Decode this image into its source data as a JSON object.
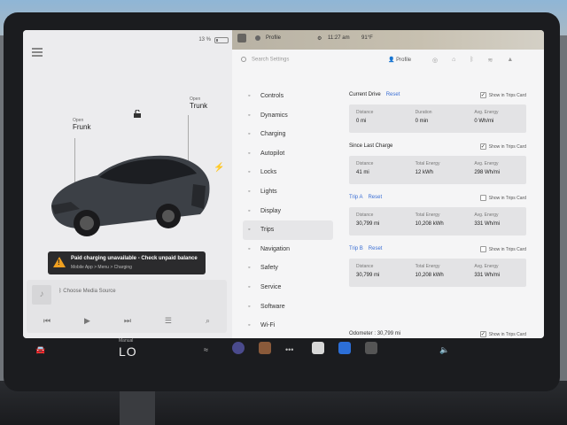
{
  "status": {
    "battery_pct": "13 %",
    "profile": "Profile",
    "time": "11:27 am",
    "temp": "91°F",
    "battery_level": 0.13
  },
  "car": {
    "frunk_state": "Open",
    "frunk_label": "Frunk",
    "trunk_state": "Open",
    "trunk_label": "Trunk"
  },
  "warning": {
    "title": "Paid charging unavailable - Check unpaid balance",
    "subtitle": "Mobile App > Menu > Charging",
    "icon": "warning-icon",
    "color": "#f0a020"
  },
  "media": {
    "source": "Choose Media Source"
  },
  "settings": {
    "search_placeholder": "Search Settings",
    "profile_label": "Profile",
    "nav": [
      {
        "label": "Controls",
        "icon": "toggle-icon"
      },
      {
        "label": "Dynamics",
        "icon": "car-icon"
      },
      {
        "label": "Charging",
        "icon": "bolt-icon"
      },
      {
        "label": "Autopilot",
        "icon": "wheel-icon"
      },
      {
        "label": "Locks",
        "icon": "lock-icon"
      },
      {
        "label": "Lights",
        "icon": "sun-icon"
      },
      {
        "label": "Display",
        "icon": "display-icon"
      },
      {
        "label": "Trips",
        "icon": "trips-icon"
      },
      {
        "label": "Navigation",
        "icon": "nav-arrow-icon"
      },
      {
        "label": "Safety",
        "icon": "safety-icon"
      },
      {
        "label": "Service",
        "icon": "wrench-icon"
      },
      {
        "label": "Software",
        "icon": "download-icon"
      },
      {
        "label": "Wi-Fi",
        "icon": "wifi-icon"
      }
    ],
    "active": "Trips"
  },
  "trips": {
    "current": {
      "title": "Current Drive",
      "reset": "Reset",
      "show": "Show in Trips Card",
      "checked": true,
      "cells": [
        {
          "label": "Distance",
          "value": "0 mi"
        },
        {
          "label": "Duration",
          "value": "0 min"
        },
        {
          "label": "Avg. Energy",
          "value": "0 Wh/mi"
        }
      ]
    },
    "since_charge": {
      "title": "Since Last Charge",
      "show": "Show in Trips Card",
      "checked": true,
      "cells": [
        {
          "label": "Distance",
          "value": "41 mi"
        },
        {
          "label": "Total Energy",
          "value": "12 kWh"
        },
        {
          "label": "Avg. Energy",
          "value": "298 Wh/mi"
        }
      ]
    },
    "trip_a": {
      "title": "Trip A",
      "reset": "Reset",
      "show": "Show in Trips Card",
      "checked": false,
      "cells": [
        {
          "label": "Distance",
          "value": "30,799 mi"
        },
        {
          "label": "Total Energy",
          "value": "10,208 kWh"
        },
        {
          "label": "Avg. Energy",
          "value": "331 Wh/mi"
        }
      ]
    },
    "trip_b": {
      "title": "Trip B",
      "reset": "Reset",
      "show": "Show in Trips Card",
      "checked": false,
      "cells": [
        {
          "label": "Distance",
          "value": "30,799 mi"
        },
        {
          "label": "Total Energy",
          "value": "10,208 kWh"
        },
        {
          "label": "Avg. Energy",
          "value": "331 Wh/mi"
        }
      ]
    },
    "odometer_label": "Odometer :",
    "odometer_value": "30,799 mi",
    "odometer_show": "Show in Trips Card",
    "odometer_checked": true
  },
  "dock": {
    "climate_label": "Manual",
    "climate_value": "LO"
  },
  "accent": "#3b6fd4"
}
